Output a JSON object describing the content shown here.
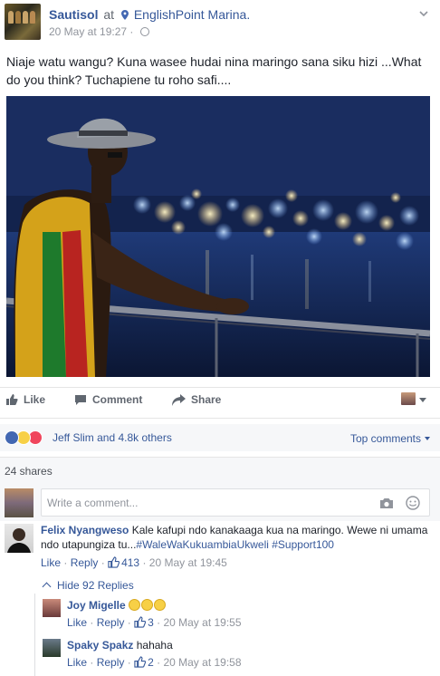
{
  "post": {
    "author": "Sautisol",
    "at_word": "at",
    "location": "EnglishPoint Marina.",
    "timestamp": "20 May at 19:27",
    "separator": "·",
    "caption": "Niaje watu wangu? Kuna wasee hudai nina maringo sana siku hizi ...What do you think? Tuchapiene tu roho safi...."
  },
  "actions": {
    "like": "Like",
    "comment": "Comment",
    "share": "Share"
  },
  "reactions": {
    "summary": "Jeff Slim and 4.8k others",
    "types": [
      "like",
      "haha",
      "love"
    ],
    "top_comments": "Top comments",
    "shares": "24 shares"
  },
  "composer": {
    "placeholder": "Write a comment..."
  },
  "comments": [
    {
      "author": "Felix Nyangweso",
      "text": "Kale kafupi ndo kanakaaga kua na maringo. Wewe ni umama ndo utapungiza tu...",
      "hashtags": "#WaleWaKukuambiaUkweli #Support100",
      "like": "Like",
      "reply": "Reply",
      "like_count": "413",
      "time": "20 May at 19:45"
    }
  ],
  "hide_replies": "Hide 92 Replies",
  "replies": [
    {
      "author": "Joy Migelle",
      "text": "😂😂😂",
      "like": "Like",
      "reply": "Reply",
      "like_count": "3",
      "time": "20 May at 19:55"
    },
    {
      "author": "Spaky Spakz",
      "text": "hahaha",
      "like": "Like",
      "reply": "Reply",
      "like_count": "2",
      "time": "20 May at 19:58"
    }
  ],
  "meta_separator": "·",
  "colors": {
    "link": "#365899",
    "like_reaction": "#4267b2",
    "haha_reaction": "#f7d046",
    "love_reaction": "#f0455c"
  }
}
